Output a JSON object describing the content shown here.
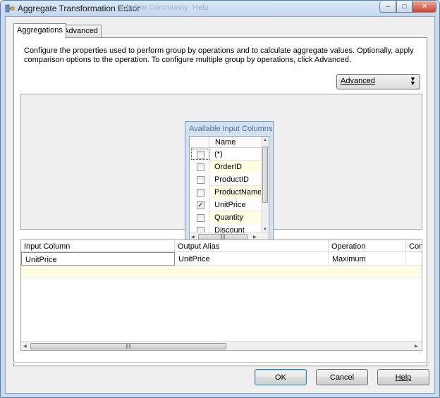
{
  "window": {
    "title": "Aggregate Transformation Editor",
    "background_menu": [
      "Window",
      "Community",
      "Help"
    ]
  },
  "tabs": [
    {
      "label": "Aggregations",
      "active": true
    },
    {
      "label": "Advanced",
      "active": false
    }
  ],
  "description": "Configure the properties used to perform group by operations and to calculate aggregate values. Optionally, apply comparison options to the operation. To configure multiple group by operations, click Advanced.",
  "mode_dropdown": {
    "value": "Advanced"
  },
  "available_columns": {
    "title": "Available Input Columns",
    "header": "Name",
    "rows": [
      {
        "name": "(*)",
        "checked": false
      },
      {
        "name": "OrderID",
        "checked": false
      },
      {
        "name": "ProductID",
        "checked": false
      },
      {
        "name": "ProductName",
        "checked": false
      },
      {
        "name": "UnitPrice",
        "checked": true
      },
      {
        "name": "Quantity",
        "checked": false
      },
      {
        "name": "Discount",
        "checked": false
      }
    ]
  },
  "aggregations_grid": {
    "columns": [
      "Input Column",
      "Output Alias",
      "Operation",
      "Comparison Flags"
    ],
    "rows": [
      {
        "input_column": "UnitPrice",
        "output_alias": "UnitPrice",
        "operation": "Maximum",
        "comparison_flags": ""
      }
    ]
  },
  "buttons": {
    "ok": "OK",
    "cancel": "Cancel",
    "help": "Help"
  },
  "colors": {
    "accent": "#3c7fb1",
    "new_row": "#fffde2",
    "frame": "#c9dcef"
  }
}
